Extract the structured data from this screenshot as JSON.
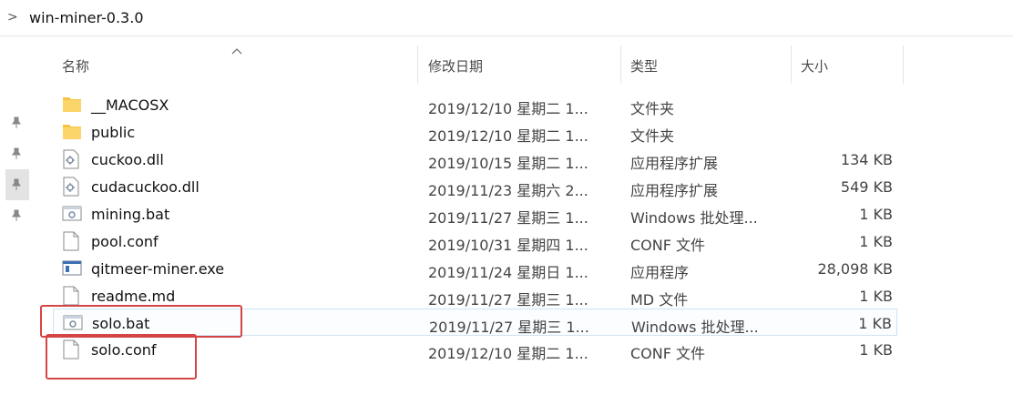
{
  "address": {
    "path": "win-miner-0.3.0",
    "chevron": ">"
  },
  "columns": {
    "name": "名称",
    "date": "修改日期",
    "type": "类型",
    "size": "大小"
  },
  "files": [
    {
      "icon": "folder-icon",
      "name": "__MACOSX",
      "date": "2019/12/10 星期二 1...",
      "type": "文件夹",
      "size": ""
    },
    {
      "icon": "folder-icon",
      "name": "public",
      "date": "2019/12/10 星期二 1...",
      "type": "文件夹",
      "size": ""
    },
    {
      "icon": "dll-file-icon",
      "name": "cuckoo.dll",
      "date": "2019/10/15 星期二 1...",
      "type": "应用程序扩展",
      "size": "134 KB"
    },
    {
      "icon": "dll-file-icon",
      "name": "cudacuckoo.dll",
      "date": "2019/11/23 星期六 2...",
      "type": "应用程序扩展",
      "size": "549 KB"
    },
    {
      "icon": "batch-file-icon",
      "name": "mining.bat",
      "date": "2019/11/27 星期三 1...",
      "type": "Windows 批处理...",
      "size": "1 KB"
    },
    {
      "icon": "document-file-icon",
      "name": "pool.conf",
      "date": "2019/10/31 星期四 1...",
      "type": "CONF 文件",
      "size": "1 KB"
    },
    {
      "icon": "exe-file-icon",
      "name": "qitmeer-miner.exe",
      "date": "2019/11/24 星期日 1...",
      "type": "应用程序",
      "size": "28,098 KB"
    },
    {
      "icon": "document-file-icon",
      "name": "readme.md",
      "date": "2019/11/27 星期三 1...",
      "type": "MD 文件",
      "size": "1 KB"
    },
    {
      "icon": "batch-file-icon",
      "name": "solo.bat",
      "date": "2019/11/27 星期三 1...",
      "type": "Windows 批处理...",
      "size": "1 KB"
    },
    {
      "icon": "document-file-icon",
      "name": "solo.conf",
      "date": "2019/12/10 星期二 1...",
      "type": "CONF 文件",
      "size": "1 KB"
    }
  ],
  "colors": {
    "highlight": "#d64545",
    "folder": "#f5c542",
    "selection": "#cfe3f5"
  }
}
